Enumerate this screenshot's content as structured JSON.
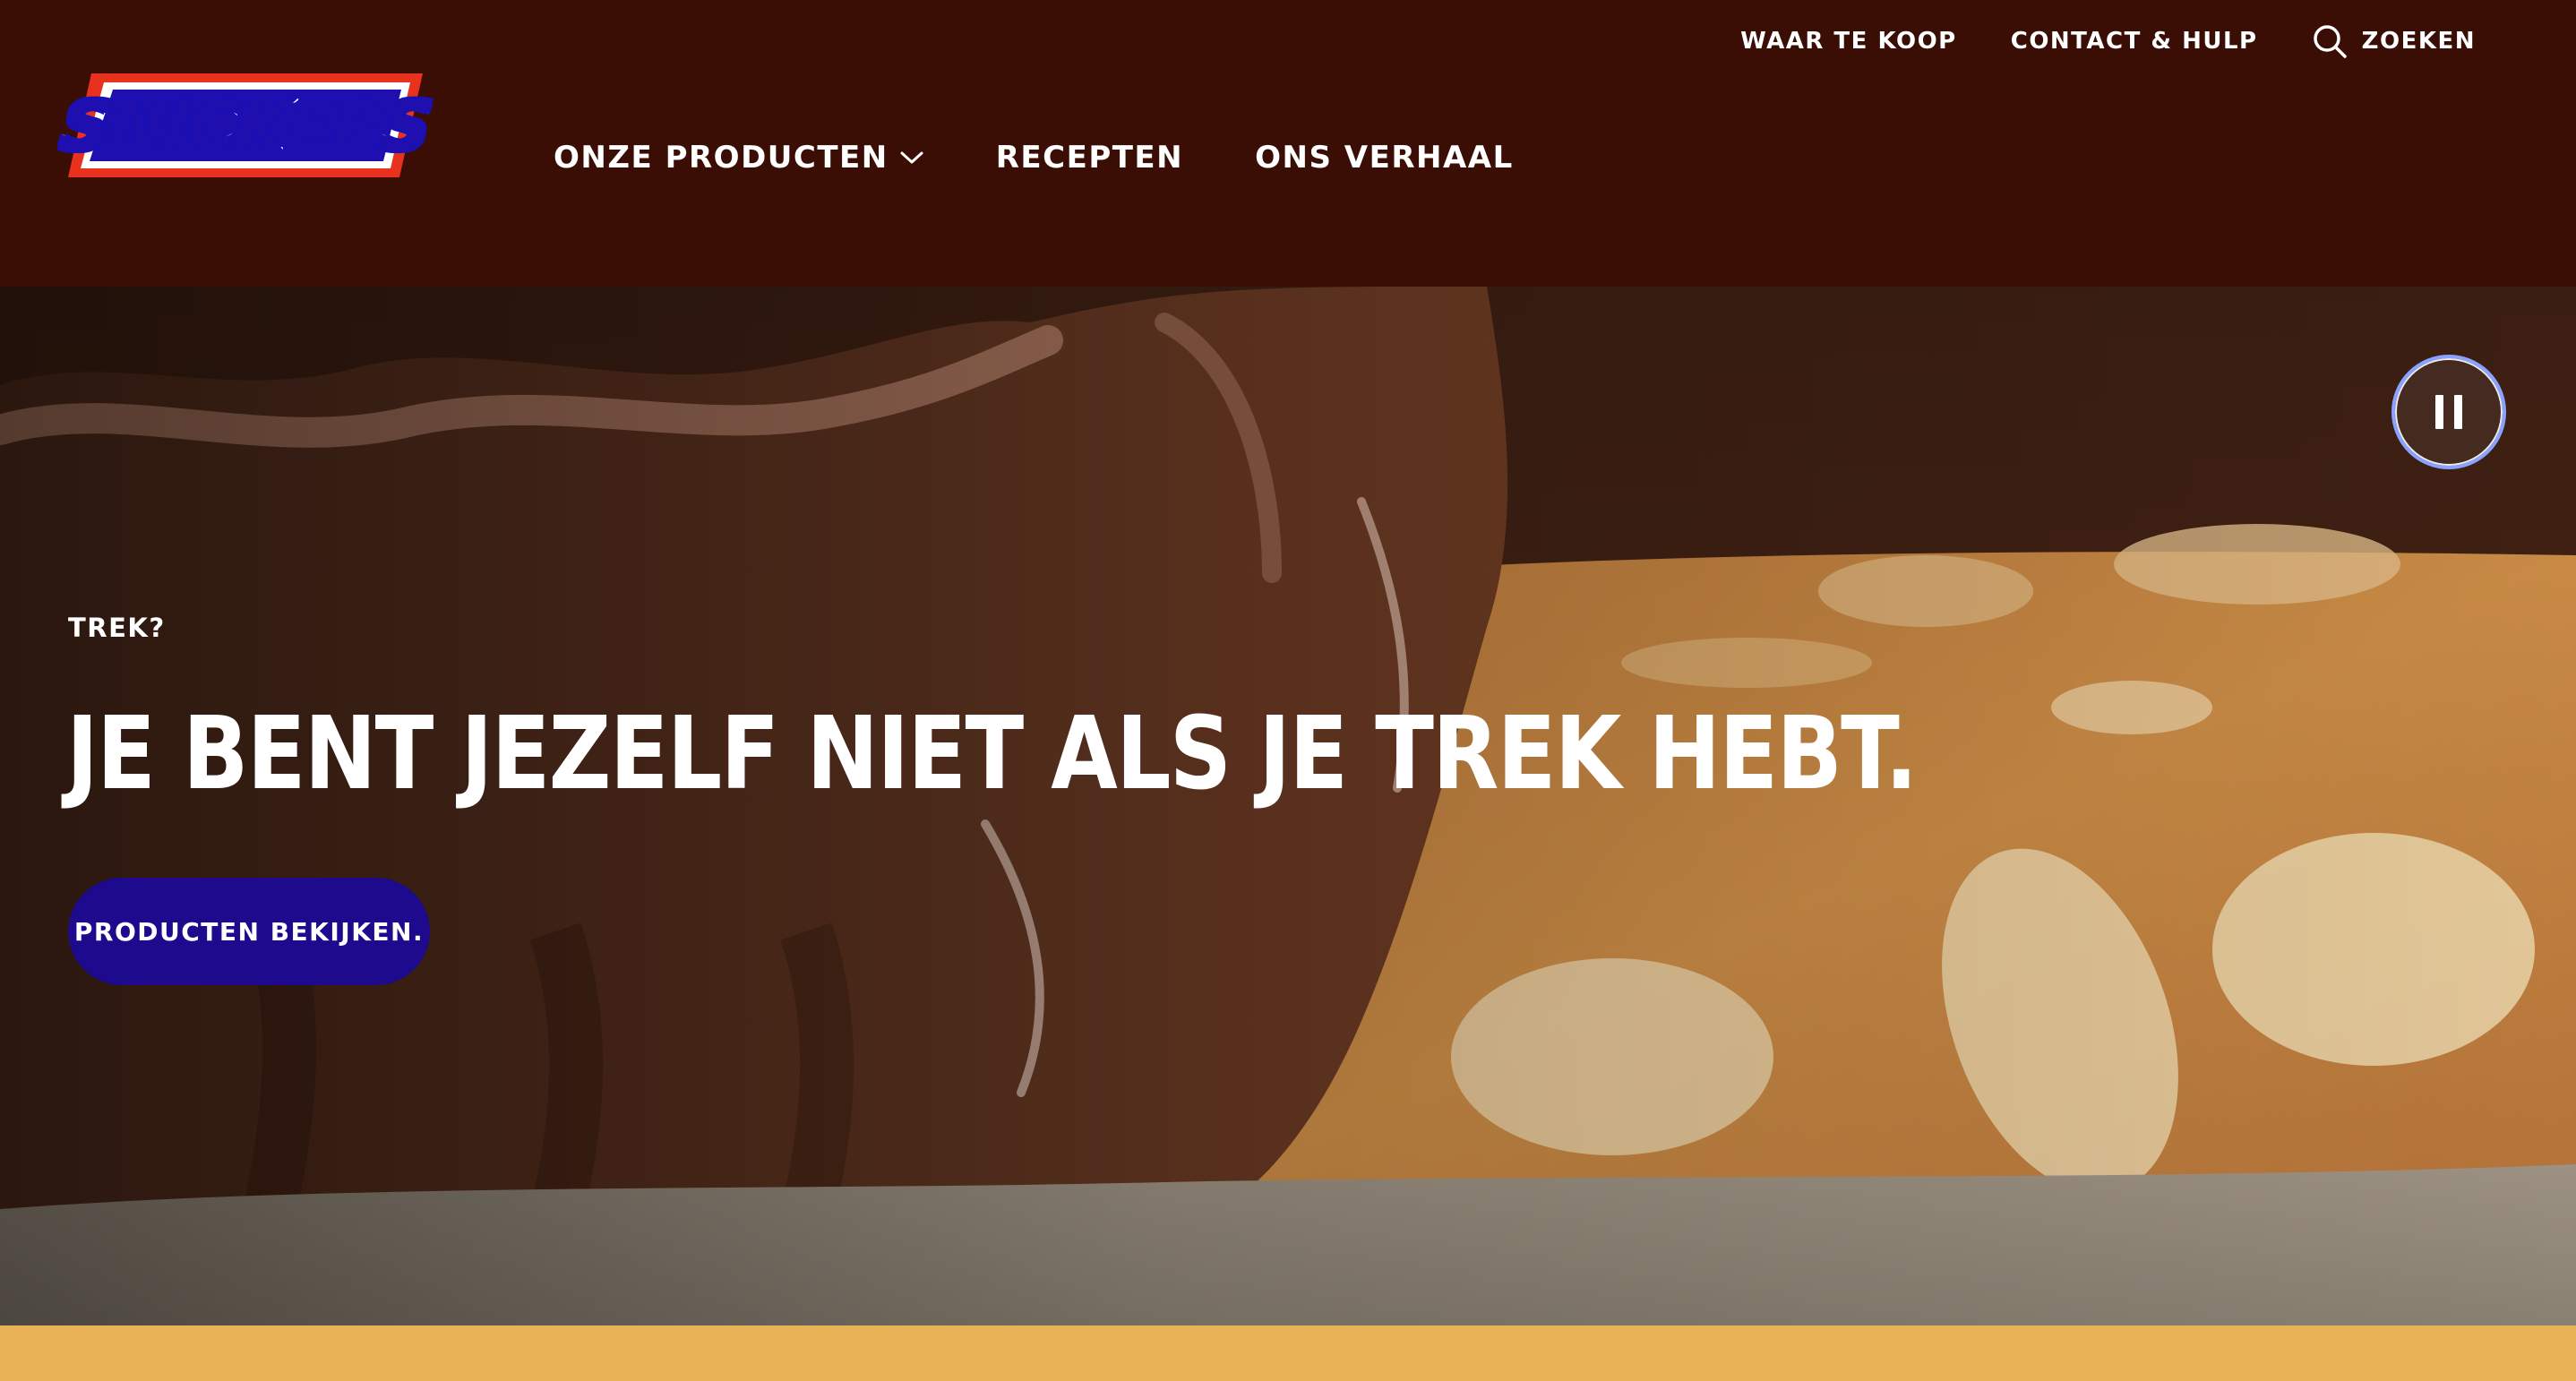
{
  "logo": {
    "text": "SNICKERS"
  },
  "utility_nav": {
    "where_to_buy": "WAAR TE KOOP",
    "contact": "CONTACT & HULP",
    "search": "ZOEKEN"
  },
  "main_nav": {
    "items": [
      {
        "label": "ONZE PRODUCTEN",
        "has_dropdown": true
      },
      {
        "label": "RECEPTEN"
      },
      {
        "label": "ONS VERHAAL"
      }
    ]
  },
  "hero": {
    "eyebrow": "TREK?",
    "headline": "JE BENT JEZELF NIET ALS JE TREK HEBT.",
    "cta_label": "PRODUCTEN BEKIJKEN.",
    "video_state": "playing"
  },
  "colors": {
    "header_bg": "#3a0d05",
    "cta_bg": "#1d0a8c",
    "bottom_strip": "#e8b257",
    "logo_red": "#e8321e",
    "logo_blue": "#1f0fae"
  },
  "icons": {
    "search": "search-icon",
    "dropdown": "chevron-down-icon",
    "pause": "pause-icon"
  }
}
